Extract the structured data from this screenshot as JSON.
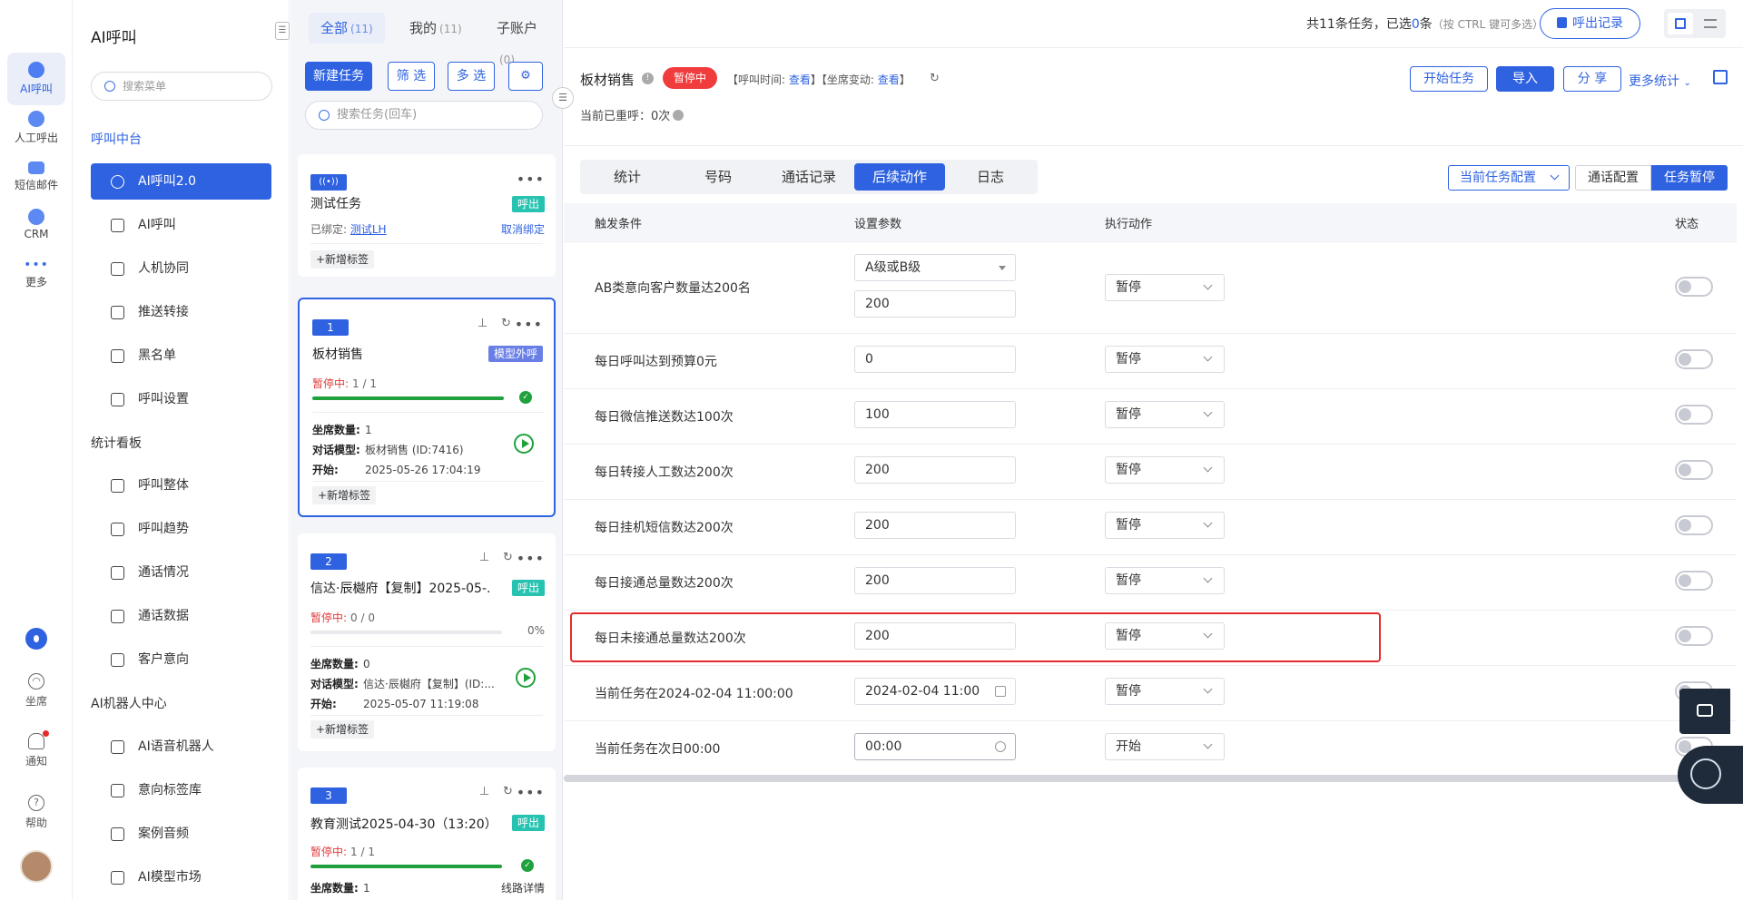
{
  "rail": {
    "items": [
      {
        "label": "AI呼叫",
        "icon": "ai-call-icon"
      },
      {
        "label": "人工呼出",
        "icon": "manual-call-icon"
      },
      {
        "label": "短信邮件",
        "icon": "sms-mail-icon"
      },
      {
        "label": "CRM",
        "icon": "crm-icon"
      },
      {
        "label": "更多",
        "icon": "more-dots-icon"
      }
    ],
    "utils": [
      {
        "label": "坐席",
        "icon": "headset-icon"
      },
      {
        "label": "通知",
        "icon": "bell-icon"
      },
      {
        "label": "帮助",
        "icon": "help-icon"
      }
    ]
  },
  "menu": {
    "title": "AI呼叫",
    "search_placeholder": "搜索菜单",
    "sections": [
      {
        "title": "呼叫中台",
        "items": [
          "AI呼叫2.0",
          "AI呼叫",
          "人机协同",
          "推送转接",
          "黑名单",
          "呼叫设置"
        ]
      },
      {
        "title": "统计看板",
        "items": [
          "呼叫整体",
          "呼叫趋势",
          "通话情况",
          "通话数据",
          "客户意向"
        ]
      },
      {
        "title": "AI机器人中心",
        "items": [
          "AI语音机器人",
          "意向标签库",
          "案例音频",
          "AI模型市场"
        ]
      }
    ]
  },
  "filter_tabs": [
    {
      "label": "全部",
      "count": "(11)"
    },
    {
      "label": "我的",
      "count": "(11)"
    },
    {
      "label": "子账户",
      "count": "(0)"
    }
  ],
  "task_toolbar": {
    "new": "新建任务",
    "filter": "筛 选",
    "multi": "多 选",
    "search_placeholder": "搜索任务(回车)"
  },
  "tasks": [
    {
      "num": "",
      "title": "测试任务",
      "tag": "呼出",
      "bound_label": "已绑定:",
      "bound_value": "测试LH",
      "unbind": "取消绑定",
      "add_tag": "+新增标签"
    },
    {
      "num": "1",
      "title": "板材销售",
      "tag": "模型外呼",
      "status": "暂停中:",
      "fraction": "1 / 1",
      "progress": 1.0,
      "seats_label": "坐席数量:",
      "seats": "1",
      "model_label": "对话模型:",
      "model": "板材销售 (ID:7416)",
      "start_label": "开始:",
      "start": "2025-05-26 17:04:19",
      "add_tag": "+新增标签"
    },
    {
      "num": "2",
      "title": "信达·辰樾府【复制】2025-05-...",
      "tag": "呼出",
      "status": "暂停中:",
      "fraction": "0 / 0",
      "percent": "0%",
      "progress": 0.0,
      "seats_label": "坐席数量:",
      "seats": "0",
      "model_label": "对话模型:",
      "model": "信达·辰樾府【复制】(ID:...",
      "start_label": "开始:",
      "start": "2025-05-07 11:19:08",
      "add_tag": "+新增标签"
    },
    {
      "num": "3",
      "title": "教育测试2025-04-30（13:20）",
      "tag": "呼出",
      "status": "暂停中:",
      "fraction": "1 / 1",
      "progress": 1.0,
      "seats_label": "坐席数量:",
      "seats": "1",
      "extra": "线路详情"
    }
  ],
  "header": {
    "summary_prefix": "共11条任务，已选",
    "summary_selected": "0",
    "summary_suffix": "条",
    "summary_hint": "（按 CTRL 键可多选）",
    "call_record": "呼出记录",
    "task_name": "板材销售",
    "status_badge": "暂停中",
    "call_time_label": "【呼叫时间:",
    "call_time_link": "查看",
    "seat_change_label": "】【坐席变动:",
    "seat_change_link": "查看",
    "bracket_close": "】",
    "redial": "当前已重呼：0次",
    "start_task": "开始任务",
    "import": "导入",
    "share": "分 享",
    "more_stats": "更多统计"
  },
  "sub_tabs": [
    "统计",
    "号码",
    "通话记录",
    "后续动作",
    "日志"
  ],
  "config": {
    "current": "当前任务配置",
    "call_config": "通话配置",
    "pause": "任务暂停"
  },
  "table": {
    "headers": [
      "触发条件",
      "设置参数",
      "执行动作",
      "状态"
    ],
    "rows": [
      {
        "cond": "AB类意向客户数量达200名",
        "select": "A级或B级",
        "value": "200",
        "action": "暂停",
        "on": false
      },
      {
        "cond": "每日呼叫达到预算0元",
        "value": "0",
        "action": "暂停",
        "on": false
      },
      {
        "cond": "每日微信推送数达100次",
        "value": "100",
        "action": "暂停",
        "on": false
      },
      {
        "cond": "每日转接人工数达200次",
        "value": "200",
        "action": "暂停",
        "on": false
      },
      {
        "cond": "每日挂机短信数达200次",
        "value": "200",
        "action": "暂停",
        "on": false
      },
      {
        "cond": "每日接通总量数达200次",
        "value": "200",
        "action": "暂停",
        "on": false
      },
      {
        "cond": "每日未接通总量数达200次",
        "value": "200",
        "action": "暂停",
        "on": false
      },
      {
        "cond": "当前任务在2024-02-04 11:00:00",
        "value": "2024-02-04 11:00",
        "action": "暂停",
        "on": false
      },
      {
        "cond": "当前任务在次日00:00",
        "value": "00:00",
        "action": "开始",
        "on": false
      }
    ]
  },
  "colors": {
    "accent": "#2f62e0",
    "danger": "#e52b2b",
    "success": "#1fa23d"
  }
}
